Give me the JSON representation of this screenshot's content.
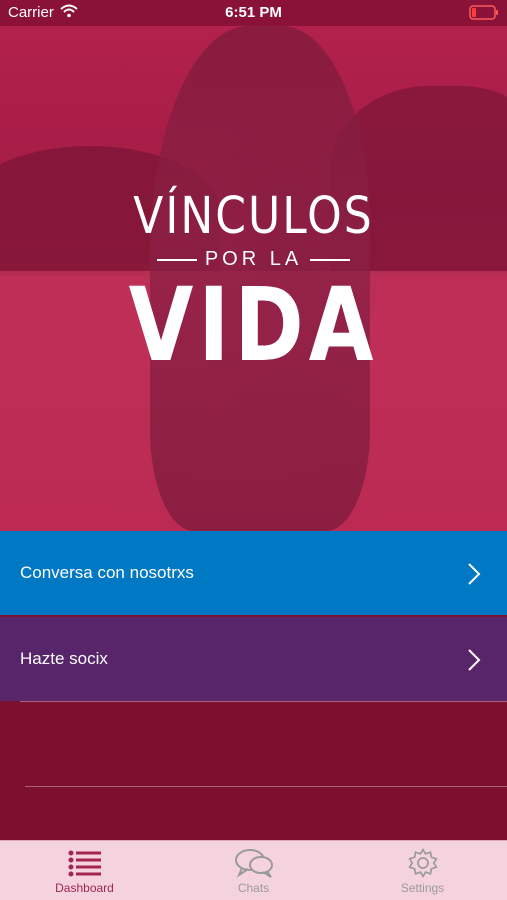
{
  "status_bar": {
    "carrier": "Carrier",
    "time": "6:51 PM"
  },
  "hero": {
    "logo_line1": "VÍNCULOS",
    "logo_line2": "POR LA",
    "logo_line3": "VIDA"
  },
  "menu": {
    "items": [
      {
        "label": "Conversa con nosotrxs",
        "color": "#0078c4"
      },
      {
        "label": "Hazte socix",
        "color": "#58246a"
      }
    ]
  },
  "tab_bar": {
    "tabs": [
      {
        "label": "Dashboard",
        "icon": "list-icon",
        "active": true
      },
      {
        "label": "Chats",
        "icon": "chat-bubbles-icon",
        "active": false
      },
      {
        "label": "Settings",
        "icon": "gear-icon",
        "active": false
      }
    ]
  },
  "colors": {
    "accent": "#a3254f",
    "background": "#7d0f2f"
  }
}
